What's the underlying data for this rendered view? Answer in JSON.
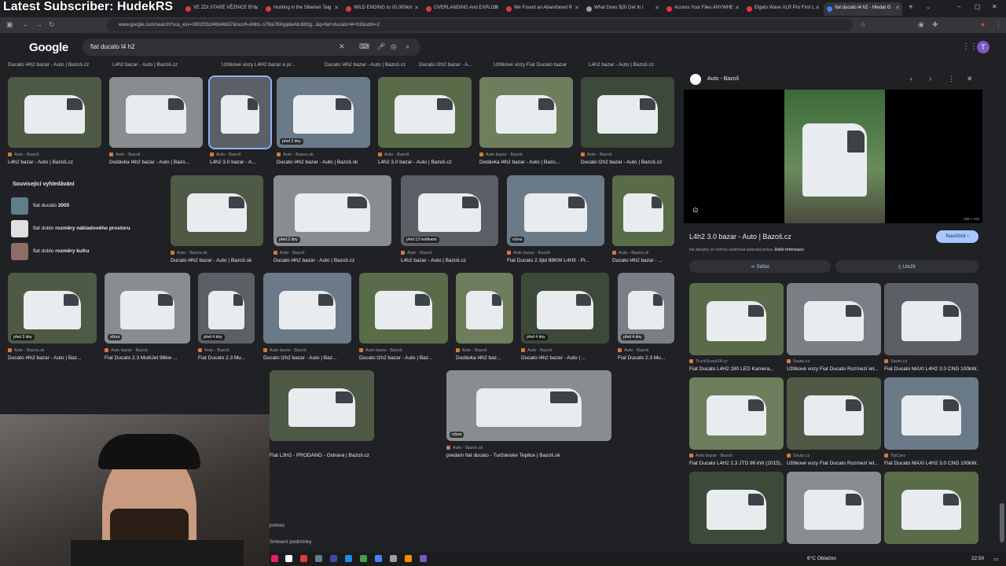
{
  "overlay_title": "Latest Subscriber: HudekRS",
  "tabs": [
    {
      "label": "VE ZDI STARÉ VĚZNICE BYL"
    },
    {
      "label": "Hunting in the Siberian Taig"
    },
    {
      "label": "WILD ENDING to 20,000km"
    },
    {
      "label": "OVERLANDING And EXPLOR"
    },
    {
      "label": "We Found an Abandoned R"
    },
    {
      "label": "What Does $20 Get In I"
    },
    {
      "label": "Access Your Files ANYWHE"
    },
    {
      "label": "Elgato Wave XLR Pro First L"
    },
    {
      "label": "fiat ducato l4 h2 - Hledat G"
    }
  ],
  "url": "www.google.com/search?sca_esv=3902f2b246b46b37&sxsrf=ANbL-n7l0a78XqqdwAlL68Og...&q=fiat+ducato+l4+h2&udm=2",
  "google": {
    "logo": "Google",
    "query": "fiat ducato l4 h2",
    "avatar_letter": "T"
  },
  "top_labels": [
    "Ducato l4h2 bazar - Auto | Bazoš.cz",
    "L4h2 bazar - Auto | Bazoš.cz",
    "Užitkové vozy L4H2 bazar a pr...",
    "Ducato l4h2 bazar - Auto | Bazoš.cz",
    "Ducato l2h2 bazar - A...",
    "Užitkové vozy Fiat Ducato bazar",
    "L4h2 bazar - Auto | Bazoš.cz"
  ],
  "row1": [
    {
      "source": "Auto - Bazoš",
      "title": "L4h2 bazar - Auto | Bazoš.cz",
      "badge": ""
    },
    {
      "source": "Auto - Bazoš",
      "title": "Dodávka l4h2 bazar - Auto | Bazo...",
      "badge": ""
    },
    {
      "source": "Auto - Bazoš",
      "title": "L4h2 3.0 bazar - A...",
      "badge": ""
    },
    {
      "source": "Auto - Bazos.sk",
      "title": "Ducato l4h2 bazar - Auto | Bazoš.sk",
      "badge": "před 3 dny"
    },
    {
      "source": "Auto - Bazoš",
      "title": "L4h2 3.0 bazar - Auto | Bazoš.cz",
      "badge": ""
    },
    {
      "source": "Auto bazar - Bazoš",
      "title": "Dodávka l4h2 bazar - Auto | Bazo...",
      "badge": ""
    },
    {
      "source": "Auto - Bazoš",
      "title": "Ducato l2h2 bazar - Auto | Bazoš.cz",
      "badge": ""
    }
  ],
  "related": {
    "heading": "Související vyhledávání",
    "items": [
      {
        "label": "fiat ducato ",
        "bold": "2005"
      },
      {
        "label": "fiat doblo ",
        "bold": "rozměry nákladového prostoru"
      },
      {
        "label": "fiat doblo ",
        "bold": "rozměry kufru"
      }
    ]
  },
  "row2": [
    {
      "source": "Auto - Bazos.sk",
      "title": "Ducato l4h2 bazar - Auto | Bazoš.sk",
      "badge": ""
    },
    {
      "source": "Auto - Bazoš",
      "title": "Ducato l4h2 bazar - Auto | Bazoš.cz",
      "badge": "před 2 dny"
    },
    {
      "source": "Auto - Bazoš",
      "title": "L4h2 bazar - Auto | Bazoš.cz",
      "badge": "před 13 hodinami"
    },
    {
      "source": "Auto bazar - Bazoš",
      "title": "Fiat Ducato 2.3jtd 88KW L4H3 - Pr...",
      "badge": "včera"
    },
    {
      "source": "Auto - Bazos.sk",
      "title": "Ducato l4h2 bazar - ...",
      "badge": ""
    }
  ],
  "row3": [
    {
      "source": "Auto - Bazos.sk",
      "title": "Ducato l4h2 bazar - Auto | Baz...",
      "badge": "před 3 dny"
    },
    {
      "source": "Auto bazar - Bazoš",
      "title": "Fiat Ducato 2.3 MultiJet 96kw ...",
      "badge": "včera"
    },
    {
      "source": "Auto - Bazoš",
      "title": "Fiat Ducato 2.3 Mu...",
      "badge": "před 4 dny"
    },
    {
      "source": "Auto bazar - Bazoš",
      "title": "Ducato l2h2 bazar - Auto | Baz...",
      "badge": ""
    },
    {
      "source": "Auto bazar - Bazoš",
      "title": "Ducato l2h2 bazar - Auto | Baz...",
      "badge": ""
    },
    {
      "source": "Auto - Bazoš",
      "title": "Dodávka l4h2 baz...",
      "badge": ""
    },
    {
      "source": "Auto - Bazoš",
      "title": "Ducato l4h2 bazar - Auto | ...",
      "badge": "před 4 dny"
    },
    {
      "source": "Auto - Bazoš",
      "title": "Fiat Ducato 2.3 Mu...",
      "badge": "před 4 dny"
    }
  ],
  "row4": [
    {
      "source": "",
      "title": "Fiat L3H2 - PRODÁNO - Ostrava | Bazoš.cz",
      "badge": ""
    },
    {
      "source": "Auto - Bazos.sk",
      "title": "predam fiat ducato - Turčianske Teplice | Bazoš.sk",
      "badge": "včera"
    }
  ],
  "footer_links": [
    "pomoc",
    "Smluvní podmínky"
  ],
  "panel": {
    "source": "Auto - Bazoš",
    "title": "L4h2 3.0 bazar - Auto | Bazoš.cz",
    "visit": "Navštívit",
    "note": "Na obrázky se mohou vztahovat autorská práva.",
    "note_link": "Další informace",
    "dims": "298 × 340",
    "share": "Sdílet",
    "save": "Uložit",
    "related": [
      {
        "source": "TruckScout24.cz",
        "title": "Fiat Ducato L4H2 180 LED Kamera..."
      },
      {
        "source": "Sauto.cz",
        "title": "Užitkové vozy Fiat Ducato Rozmezí let..."
      },
      {
        "source": "Sauto.cz",
        "title": "Fiat Ducato MAXI L4H2 3.0 CNG 100kW..."
      },
      {
        "source": "Auto bazar - Bazoš",
        "title": "Fiat Ducato L4H2 2.3 JTD 96 kW (2015)..."
      },
      {
        "source": "Sauto.cz",
        "title": "Užitkové vozy Fiat Ducato Rozmezí let..."
      },
      {
        "source": "TipCars",
        "title": "Fiat Ducato MAXI L4H2 3.0 CNG 100kW..."
      },
      {
        "source": "",
        "title": ""
      },
      {
        "source": "",
        "title": ""
      },
      {
        "source": "",
        "title": ""
      }
    ]
  },
  "taskbar": {
    "weather": "6°C  Oblačno",
    "time": "22:50"
  }
}
